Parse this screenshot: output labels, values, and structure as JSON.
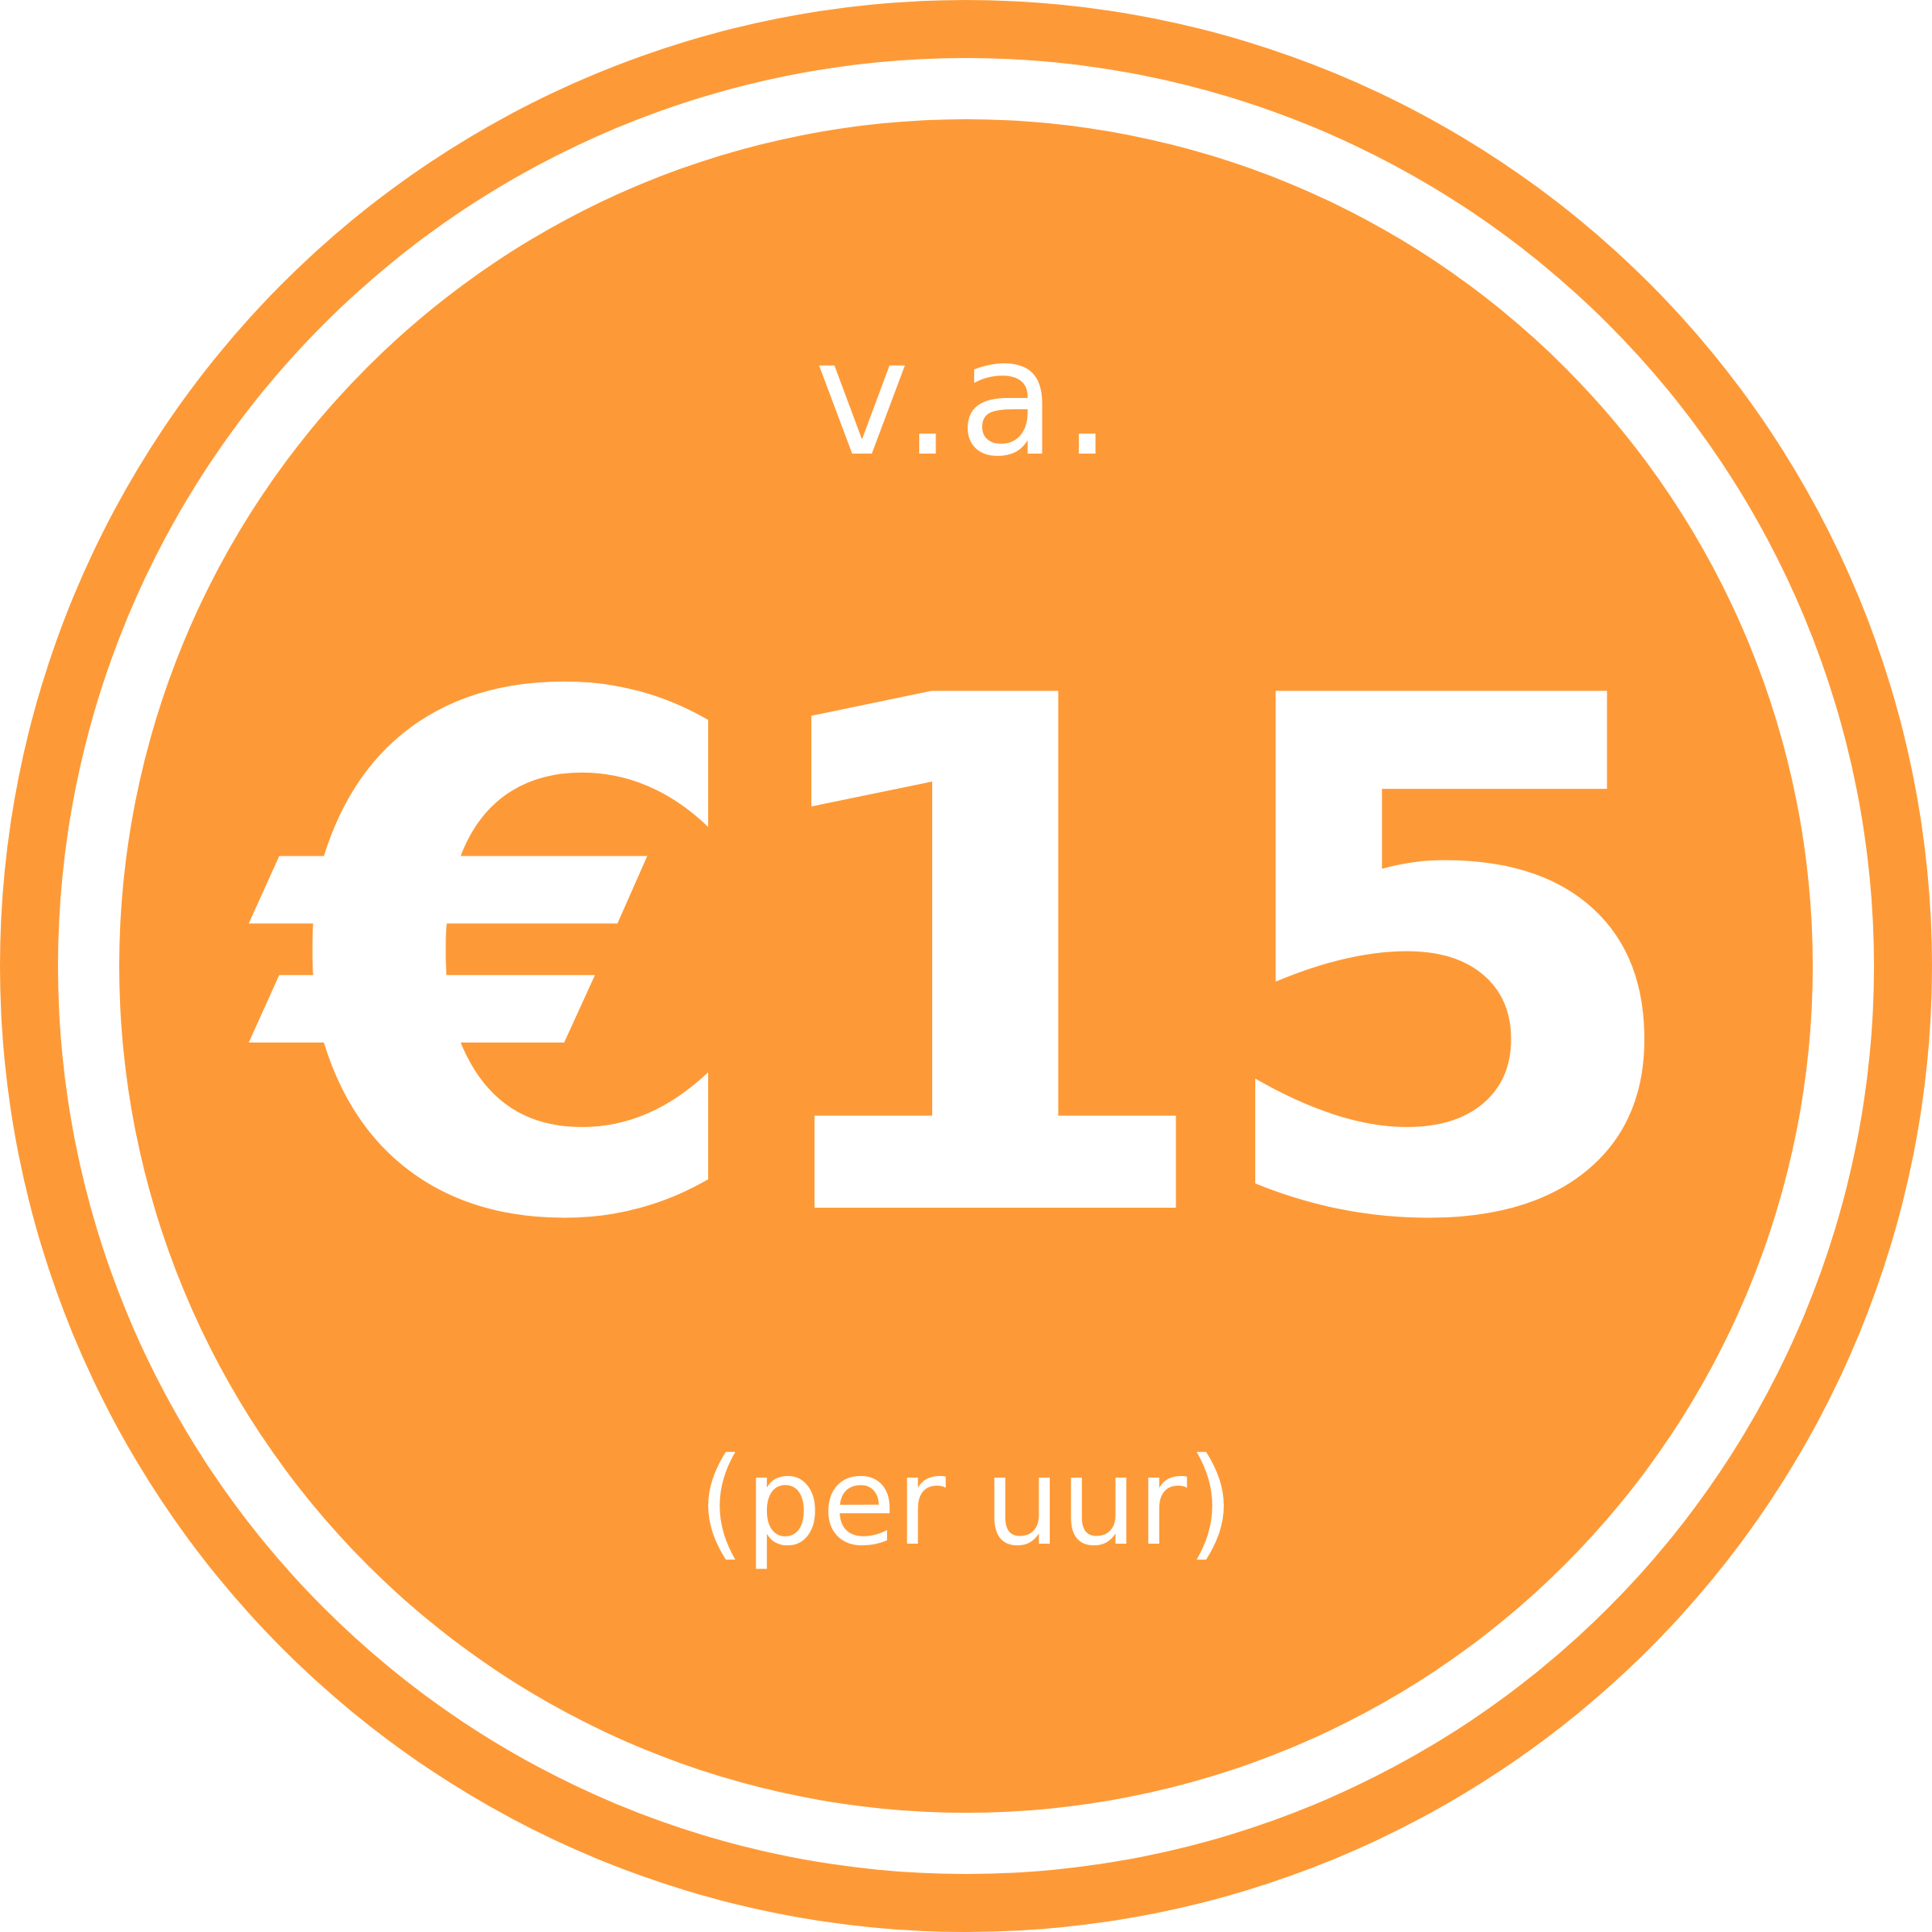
{
  "badge": {
    "prefix": "v.a.",
    "price": "€15",
    "suffix": "(per uur)"
  },
  "colors": {
    "accent": "#FD9A37",
    "text": "#FFFFFF",
    "ring": "#FFFFFF"
  }
}
